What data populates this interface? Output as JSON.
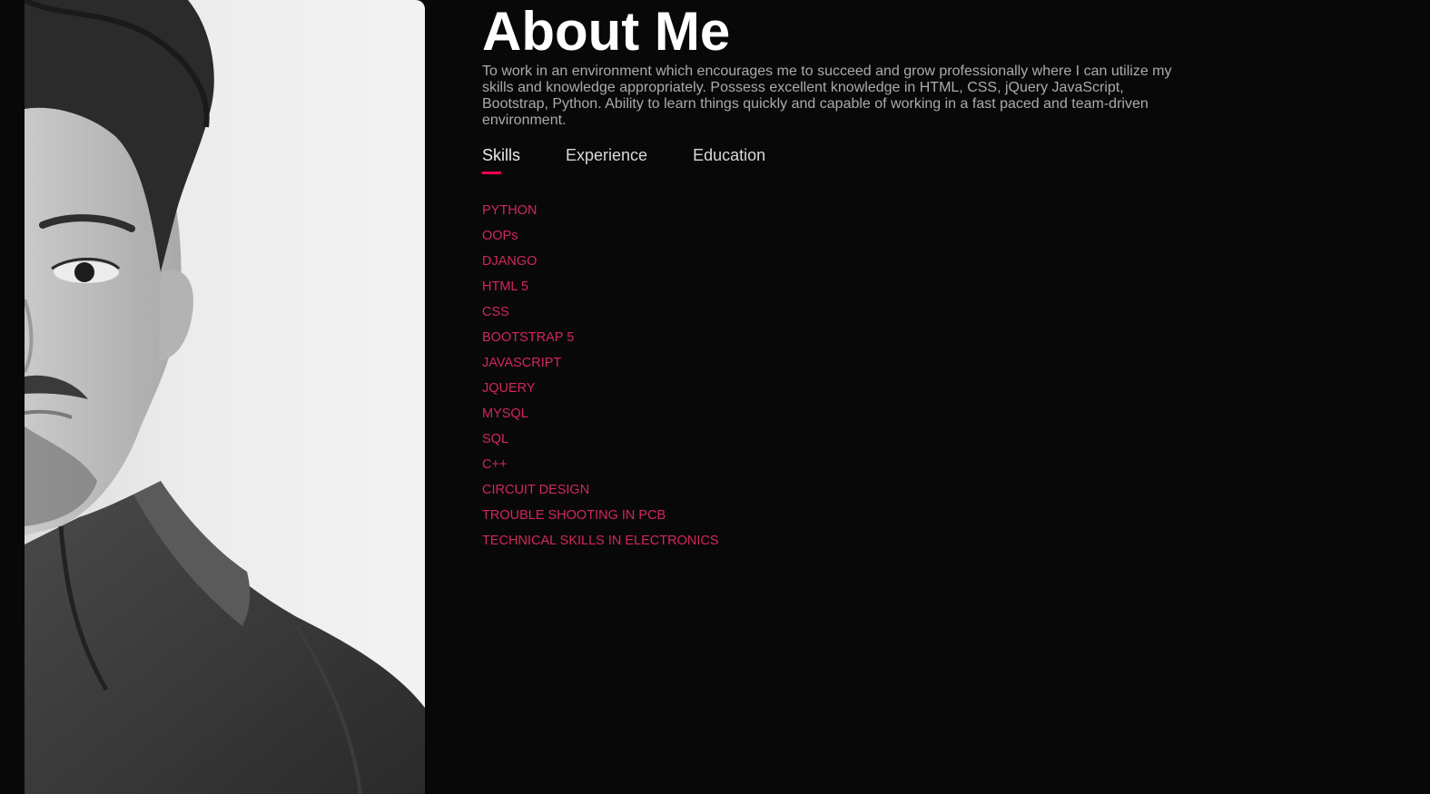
{
  "about": {
    "title": "About Me",
    "intro": "To work in an environment which encourages me to succeed and grow professionally where I can utilize my skills and knowledge appropriately. Possess excellent knowledge in HTML, CSS, jQuery JavaScript, Bootstrap, Python. Ability to learn things quickly and capable of working in a fast paced and team-driven environment."
  },
  "tabs": [
    {
      "label": "Skills",
      "active": true
    },
    {
      "label": "Experience",
      "active": false
    },
    {
      "label": "Education",
      "active": false
    }
  ],
  "skills": [
    "PYTHON",
    "OOPs",
    "DJANGO",
    "HTML 5",
    "CSS",
    "BOOTSTRAP 5",
    "JAVASCRIPT",
    "JQUERY",
    "MYSQL",
    "SQL",
    "C++",
    "CIRCUIT DESIGN",
    "TROUBLE SHOOTING IN PCB",
    "TECHNICAL SKILLS IN ELECTRONICS"
  ],
  "colors": {
    "background": "#080808",
    "accent": "#ff004f",
    "skill_text": "#d3275b",
    "title": "#ffffff",
    "body_text": "#ababab"
  }
}
